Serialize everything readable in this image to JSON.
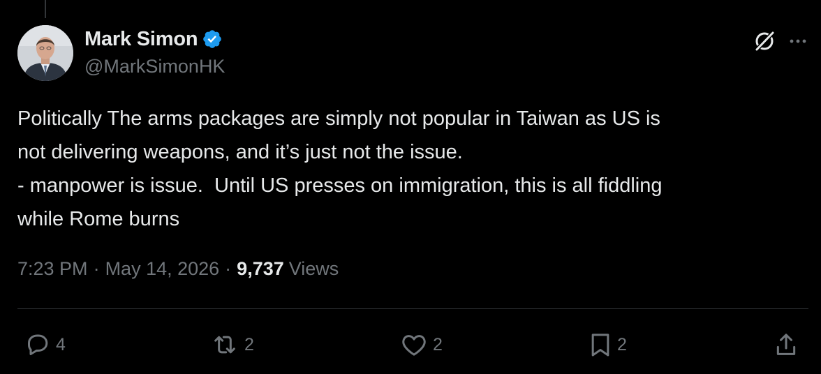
{
  "author": {
    "display_name": "Mark Simon",
    "handle": "@MarkSimonHK",
    "verified": true
  },
  "post": {
    "text": "Politically The arms packages are simply not popular in Taiwan as US is\nnot delivering weapons, and it’s just not the issue.\n- manpower is issue.  Until US presses on immigration, this is all fiddling\nwhile Rome burns",
    "time": "7:23 PM",
    "separator": "·",
    "date": "May 14, 2026",
    "views_count": "9,737",
    "views_label": "Views"
  },
  "actions": {
    "replies": "4",
    "reposts": "2",
    "likes": "2",
    "bookmarks": "2"
  },
  "icons": {
    "avatar": "avatar-photo",
    "verified": "verified-badge-icon",
    "grok": "grok-icon",
    "more": "more-icon",
    "reply": "reply-icon",
    "repost": "repost-icon",
    "like": "heart-icon",
    "bookmark": "bookmark-icon",
    "share": "share-icon"
  },
  "colors": {
    "background": "#000000",
    "primary_text": "#e7e9ea",
    "secondary_text": "#71767b",
    "verified_blue": "#1d9bf0",
    "divider": "#2f3336"
  }
}
